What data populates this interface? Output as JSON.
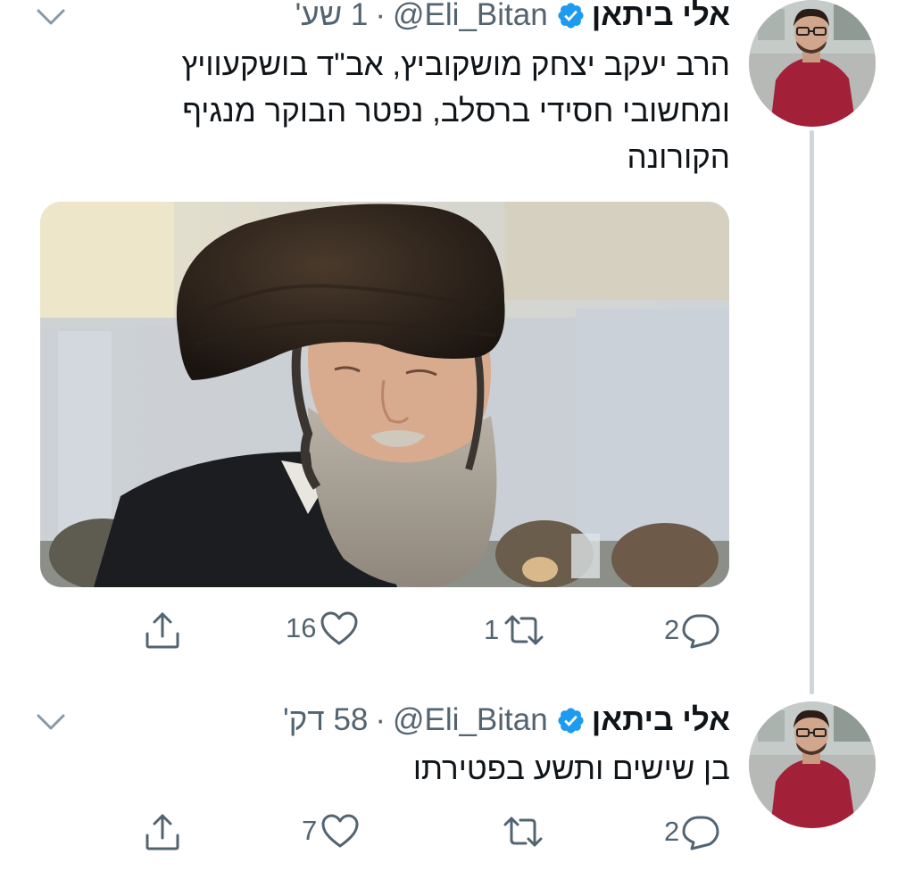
{
  "tweets": [
    {
      "name": "אלי ביתאן",
      "handle": "@Eli_Bitan",
      "separator": "·",
      "time": "1 שע'",
      "text_lines": [
        "הרב יעקב יצחק מושקוביץ, אב\"ד בושקעוויץ",
        "ומחשובי חסידי ברסלב, נפטר הבוקר מנגיף",
        "הקורונה"
      ],
      "has_media": true,
      "reply_count": "2",
      "retweet_count": "1",
      "like_count": "16",
      "icons": [
        "reply-icon",
        "retweet-icon",
        "like-icon",
        "share-icon",
        "chevron-down-icon",
        "verified-badge-icon"
      ]
    },
    {
      "name": "אלי ביתאן",
      "handle": "@Eli_Bitan",
      "separator": "·",
      "time": "58 דק'",
      "text_lines": [
        "בן שישים ותשע בפטירתו"
      ],
      "has_media": false,
      "reply_count": "2",
      "retweet_count": "",
      "like_count": "7",
      "icons": [
        "reply-icon",
        "retweet-icon",
        "like-icon",
        "share-icon",
        "chevron-down-icon",
        "verified-badge-icon"
      ]
    }
  ],
  "colors": {
    "text": "#0f1419",
    "secondary_text": "#536471",
    "verified_blue": "#1d9bf0",
    "thread_line": "#cdd6dd"
  }
}
